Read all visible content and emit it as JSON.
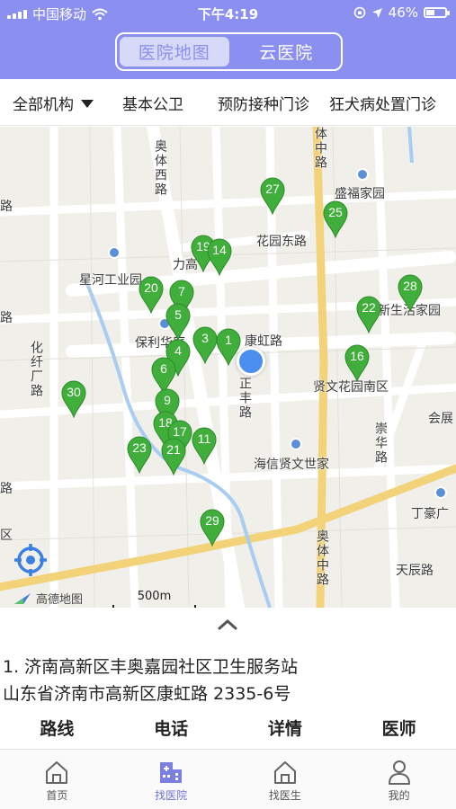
{
  "status_bar": {
    "carrier": "中国移动",
    "time": "下午4:19",
    "battery": "46%",
    "battery_level": 0.46
  },
  "header": {
    "segments": [
      {
        "label": "医院地图",
        "active": true
      },
      {
        "label": "云医院",
        "active": false
      }
    ]
  },
  "filters": {
    "all_orgs": "全部机构",
    "items": [
      "基本公卫",
      "预防接种门诊",
      "狂犬病处置门诊"
    ]
  },
  "map": {
    "road_labels": [
      "奥体西路",
      "花园东路",
      "康虹路",
      "正丰路",
      "化纤厂路",
      "体中路",
      "崇华路",
      "天辰路",
      "奥体中路",
      "会展",
      "路",
      "路",
      "路",
      "区"
    ],
    "place_labels": [
      "盛福家园",
      "星河工业园",
      "力高",
      "保利华庭",
      "新生活家园",
      "贤文花园南区",
      "海信贤文世家",
      "丁豪广"
    ],
    "pins": [
      "27",
      "25",
      "19",
      "14",
      "20",
      "7",
      "5",
      "3",
      "1",
      "4",
      "6",
      "9",
      "18",
      "17",
      "23",
      "21",
      "11",
      "28",
      "22",
      "16",
      "30",
      "29"
    ],
    "provider": "高德地图",
    "scale": "500m"
  },
  "selected": {
    "title": "1.   济南高新区丰奥嘉园社区卫生服务站",
    "address": "山东省济南市高新区康虹路 2335-6号"
  },
  "actions": [
    "路线",
    "电话",
    "详情",
    "医师"
  ],
  "tabs": [
    {
      "label": "首页",
      "icon": "home-icon",
      "active": false
    },
    {
      "label": "找医院",
      "icon": "hospital-icon",
      "active": true
    },
    {
      "label": "找医生",
      "icon": "doctor-icon",
      "active": false
    },
    {
      "label": "我的",
      "icon": "profile-icon",
      "active": false
    }
  ],
  "colors": {
    "header": "#8a8ff0",
    "pin": "#3fae3a",
    "location": "#4a8ff0",
    "active_tab": "#6b70d8"
  }
}
